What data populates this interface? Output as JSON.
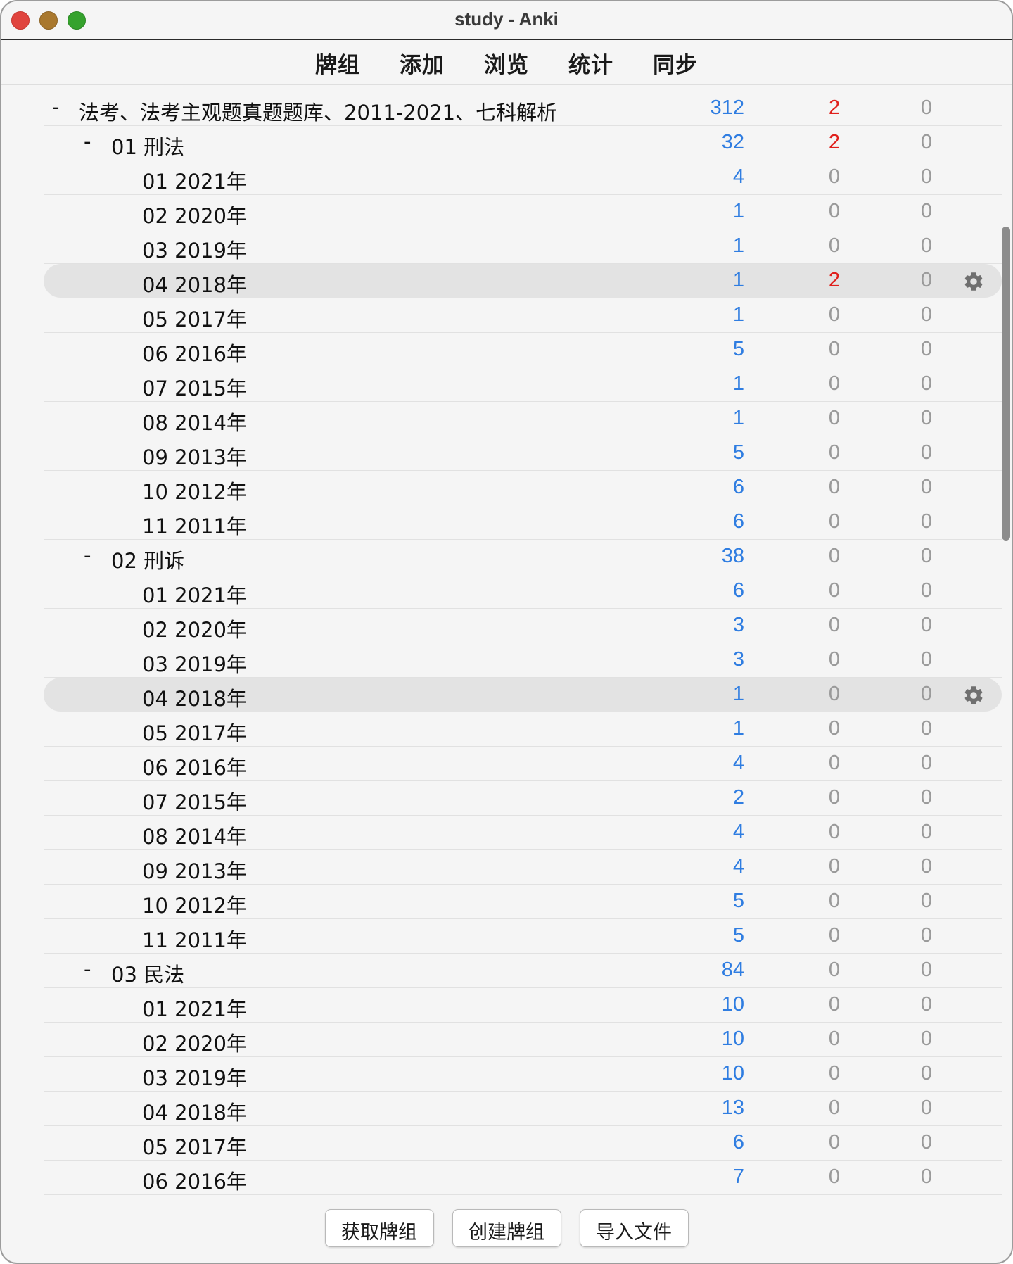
{
  "window": {
    "title": "study - Anki"
  },
  "toolbar": [
    "牌组",
    "添加",
    "浏览",
    "统计",
    "同步"
  ],
  "decks": [
    {
      "name": "法考、法考主观题真题题库、2011-2021、七科解析",
      "level": 0,
      "collapsible": true,
      "new": "312",
      "learn": "2",
      "review": "0",
      "learn_red": true,
      "current": false
    },
    {
      "name": "01 刑法",
      "level": 1,
      "collapsible": true,
      "new": "32",
      "learn": "2",
      "review": "0",
      "learn_red": true,
      "current": false
    },
    {
      "name": "01 2021年",
      "level": 2,
      "new": "4",
      "learn": "0",
      "review": "0"
    },
    {
      "name": "02 2020年",
      "level": 2,
      "new": "1",
      "learn": "0",
      "review": "0"
    },
    {
      "name": "03 2019年",
      "level": 2,
      "new": "1",
      "learn": "0",
      "review": "0"
    },
    {
      "name": "04 2018年",
      "level": 2,
      "new": "1",
      "learn": "2",
      "review": "0",
      "learn_red": true,
      "current": true
    },
    {
      "name": "05 2017年",
      "level": 2,
      "new": "1",
      "learn": "0",
      "review": "0"
    },
    {
      "name": "06 2016年",
      "level": 2,
      "new": "5",
      "learn": "0",
      "review": "0"
    },
    {
      "name": "07 2015年",
      "level": 2,
      "new": "1",
      "learn": "0",
      "review": "0"
    },
    {
      "name": "08 2014年",
      "level": 2,
      "new": "1",
      "learn": "0",
      "review": "0"
    },
    {
      "name": "09 2013年",
      "level": 2,
      "new": "5",
      "learn": "0",
      "review": "0"
    },
    {
      "name": "10 2012年",
      "level": 2,
      "new": "6",
      "learn": "0",
      "review": "0"
    },
    {
      "name": "11 2011年",
      "level": 2,
      "new": "6",
      "learn": "0",
      "review": "0"
    },
    {
      "name": "02 刑诉",
      "level": 1,
      "collapsible": true,
      "new": "38",
      "learn": "0",
      "review": "0"
    },
    {
      "name": "01 2021年",
      "level": 2,
      "new": "6",
      "learn": "0",
      "review": "0"
    },
    {
      "name": "02 2020年",
      "level": 2,
      "new": "3",
      "learn": "0",
      "review": "0"
    },
    {
      "name": "03 2019年",
      "level": 2,
      "new": "3",
      "learn": "0",
      "review": "0"
    },
    {
      "name": "04 2018年",
      "level": 2,
      "new": "1",
      "learn": "0",
      "review": "0",
      "current": true
    },
    {
      "name": "05 2017年",
      "level": 2,
      "new": "1",
      "learn": "0",
      "review": "0"
    },
    {
      "name": "06 2016年",
      "level": 2,
      "new": "4",
      "learn": "0",
      "review": "0"
    },
    {
      "name": "07 2015年",
      "level": 2,
      "new": "2",
      "learn": "0",
      "review": "0"
    },
    {
      "name": "08 2014年",
      "level": 2,
      "new": "4",
      "learn": "0",
      "review": "0"
    },
    {
      "name": "09 2013年",
      "level": 2,
      "new": "4",
      "learn": "0",
      "review": "0"
    },
    {
      "name": "10 2012年",
      "level": 2,
      "new": "5",
      "learn": "0",
      "review": "0"
    },
    {
      "name": "11 2011年",
      "level": 2,
      "new": "5",
      "learn": "0",
      "review": "0"
    },
    {
      "name": "03 民法",
      "level": 1,
      "collapsible": true,
      "new": "84",
      "learn": "0",
      "review": "0"
    },
    {
      "name": "01 2021年",
      "level": 2,
      "new": "10",
      "learn": "0",
      "review": "0"
    },
    {
      "name": "02 2020年",
      "level": 2,
      "new": "10",
      "learn": "0",
      "review": "0"
    },
    {
      "name": "03 2019年",
      "level": 2,
      "new": "10",
      "learn": "0",
      "review": "0"
    },
    {
      "name": "04 2018年",
      "level": 2,
      "new": "13",
      "learn": "0",
      "review": "0"
    },
    {
      "name": "05 2017年",
      "level": 2,
      "new": "6",
      "learn": "0",
      "review": "0"
    },
    {
      "name": "06 2016年",
      "level": 2,
      "new": "7",
      "learn": "0",
      "review": "0"
    }
  ],
  "collapse_symbol": "-",
  "bottom_buttons": [
    "获取牌组",
    "创建牌组",
    "导入文件"
  ],
  "colors": {
    "new": "#2f7de1",
    "learn_active": "#e0201c",
    "zero": "#9a9a9a"
  },
  "icons": {
    "options": "gear-icon"
  }
}
